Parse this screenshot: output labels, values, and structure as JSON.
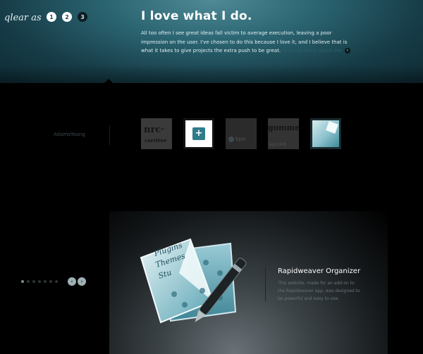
{
  "header": {
    "logo": "qlear as",
    "pages": [
      "1",
      "2",
      "3"
    ],
    "active_pages": [
      0,
      1
    ],
    "title": "I love what I do.",
    "intro": "All too often I see great ideas fall victim to average execution, leaving a poor impression on the user. I've chosen to do this because I love it, and I believe that is what it takes to give projects the extra push to be great.",
    "intro_link": "Find out more about me"
  },
  "portfolio": {
    "label": "AdamsYoung",
    "thumbs": [
      {
        "name": "nrc-carriere",
        "line1": "nrc·",
        "line2": "carrière"
      },
      {
        "name": "rapidweaver-plus"
      },
      {
        "name": "kpn",
        "text": "kpn"
      },
      {
        "name": "gommer",
        "line1": "gommer",
        "line2": "ays  Ord"
      },
      {
        "name": "rapidweaver-organizer"
      }
    ]
  },
  "slider": {
    "dot_count": 7,
    "active_dot": 0,
    "prev_label": "‹",
    "next_label": "›"
  },
  "feature": {
    "art_text1": "Plugins",
    "art_text2": "Themes",
    "art_text3": "Stu",
    "title": "Rapidweaver Organizer",
    "description": "This website, made for an add-on to the Rapidweaver app, was designed to be powerful and easy to use."
  },
  "colors": {
    "accent": "#2e7b8a",
    "hero_dark": "#0e2a33",
    "hero_light": "#4f8a96"
  }
}
